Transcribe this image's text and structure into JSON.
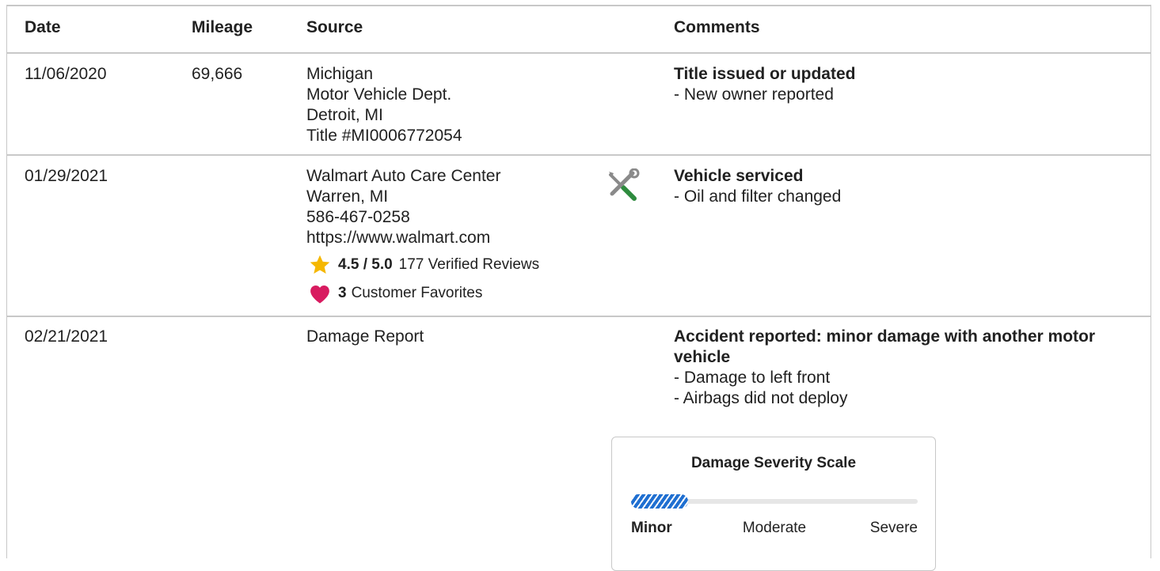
{
  "headers": {
    "date": "Date",
    "mileage": "Mileage",
    "source": "Source",
    "comments": "Comments"
  },
  "rows": [
    {
      "date": "11/06/2020",
      "mileage": "69,666",
      "source": [
        "Michigan",
        "Motor Vehicle Dept.",
        "Detroit, MI",
        "Title #MI0006772054"
      ],
      "comment_title": "Title issued or updated",
      "comment_items": [
        "- New owner reported"
      ]
    },
    {
      "date": "01/29/2021",
      "mileage": "",
      "source": [
        "Walmart Auto Care Center",
        "Warren, MI",
        "586-467-0258",
        "https://www.walmart.com"
      ],
      "rating": {
        "score": "4.5 / 5.0",
        "reviews": "177 Verified Reviews"
      },
      "favorites": {
        "count": "3",
        "label": "Customer Favorites"
      },
      "icon": "wrench-screwdriver-icon",
      "comment_title": "Vehicle serviced",
      "comment_items": [
        "- Oil and filter changed"
      ]
    },
    {
      "date": "02/21/2021",
      "mileage": "",
      "source": [
        "Damage Report"
      ],
      "comment_title_lines": [
        "Accident reported: minor damage with another motor",
        "vehicle"
      ],
      "comment_items": [
        "- Damage to left front",
        "- Airbags did not deploy"
      ]
    }
  ],
  "severity_scale": {
    "title": "Damage Severity Scale",
    "level": 0.2,
    "labels": {
      "minor": "Minor",
      "moderate": "Moderate",
      "severe": "Severe"
    },
    "selected": "Minor"
  },
  "colors": {
    "star": "#f5b700",
    "heart": "#d81b60",
    "fill": "#1f6fd1",
    "border": "#c8c8c8"
  }
}
